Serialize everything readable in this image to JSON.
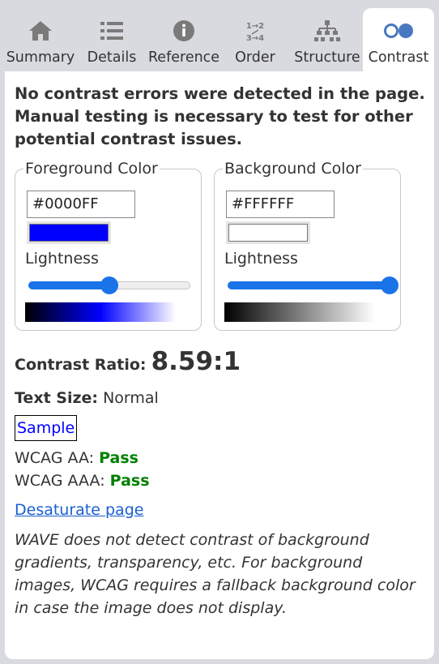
{
  "tabs": [
    {
      "label": "Summary",
      "icon": "home-icon"
    },
    {
      "label": "Details",
      "icon": "list-icon"
    },
    {
      "label": "Reference",
      "icon": "info-icon"
    },
    {
      "label": "Order",
      "icon": "order-icon",
      "icon_text_top": "1→2",
      "icon_text_bottom": "3→4"
    },
    {
      "label": "Structure",
      "icon": "structure-icon"
    },
    {
      "label": "Contrast",
      "icon": "contrast-icon",
      "active": true
    }
  ],
  "intro": "No contrast errors were detected in the page. Manual testing is necessary to test for other potential contrast issues.",
  "foreground": {
    "legend": "Foreground Color",
    "hex": "#0000FF",
    "lightness_label": "Lightness",
    "lightness_value": 0.5
  },
  "background": {
    "legend": "Background Color",
    "hex": "#FFFFFF",
    "lightness_label": "Lightness",
    "lightness_value": 1.0
  },
  "contrast": {
    "label": "Contrast Ratio:",
    "value": "8.59:1"
  },
  "text_size": {
    "label": "Text Size:",
    "value": "Normal"
  },
  "sample": "Sample",
  "wcag_aa": {
    "label": "WCAG AA:",
    "result": "Pass"
  },
  "wcag_aaa": {
    "label": "WCAG AAA:",
    "result": "Pass"
  },
  "desaturate": "Desaturate page",
  "note": "WAVE does not detect contrast of background gradients, transparency, etc. For background images, WCAG requires a fallback background color in case the image does not display.",
  "colors": {
    "accent": "#1a73e8",
    "pass": "#008000",
    "icon": "#7a7a7a",
    "contrast_icon": "#4a78c0"
  }
}
